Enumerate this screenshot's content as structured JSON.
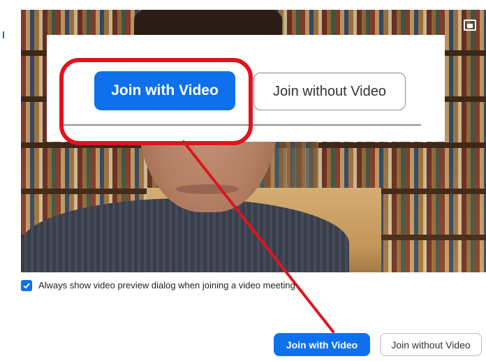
{
  "callout": {
    "join_with_video": "Join with Video",
    "join_without_video": "Join without Video"
  },
  "preview": {
    "always_show_label": "Always show video preview dialog when joining a video meeting",
    "always_show_checked": true
  },
  "actions": {
    "join_with_video": "Join with Video",
    "join_without_video": "Join without Video"
  },
  "colors": {
    "accent": "#0e71eb",
    "annotation": "#e0141e"
  }
}
